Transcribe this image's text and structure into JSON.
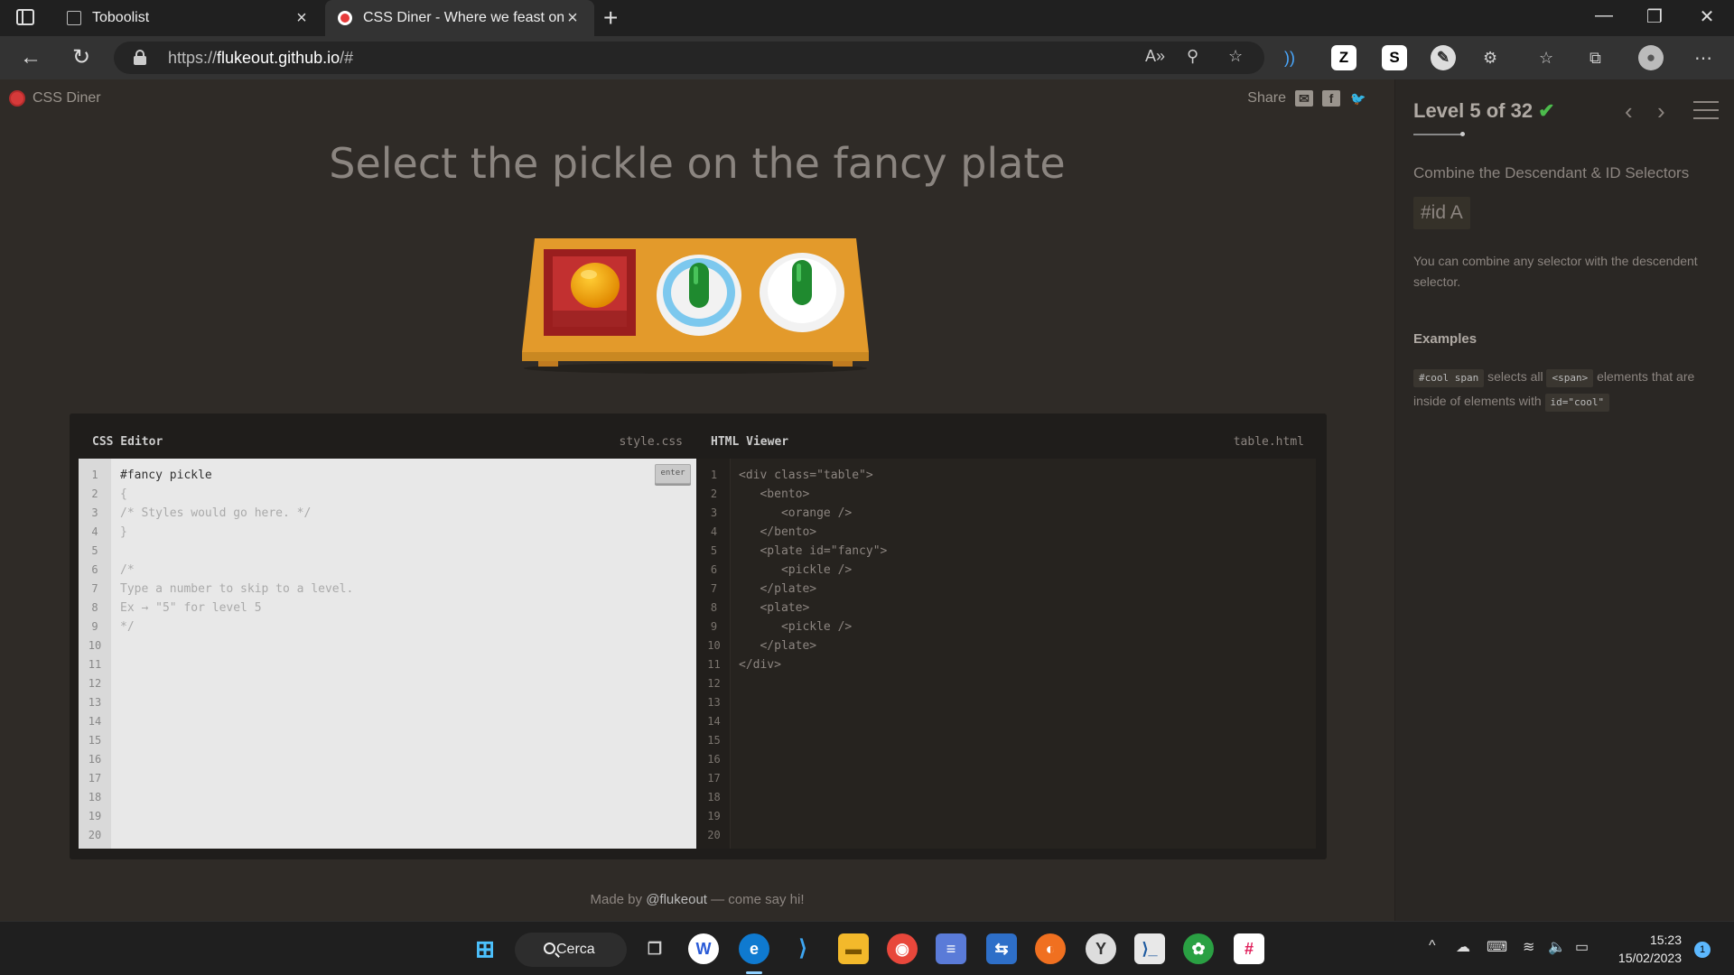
{
  "browser": {
    "tabs": [
      {
        "title": "Toboolist",
        "active": false
      },
      {
        "title": "CSS Diner - Where we feast on C",
        "active": true
      }
    ],
    "url_prefix": "https://",
    "url_host": "flukeout.github.io",
    "url_suffix": "/#"
  },
  "game": {
    "logo": "CSS Diner",
    "share_label": "Share",
    "order": "Select the pickle on the fancy plate",
    "css_editor": {
      "title": "CSS Editor",
      "filename": "style.css",
      "enter_label": "enter",
      "typed": "#fancy pickle",
      "lines": [
        "{",
        "/* Styles would go here. */",
        "}",
        "",
        "/*",
        "Type a number to skip to a level.",
        "Ex → \"5\" for level 5",
        "*/"
      ]
    },
    "html_viewer": {
      "title": "HTML Viewer",
      "filename": "table.html",
      "lines": [
        "<div class=\"table\">",
        "   <bento>",
        "      <orange />",
        "   </bento>",
        "   <plate id=\"fancy\">",
        "      <pickle />",
        "   </plate>",
        "   <plate>",
        "      <pickle />",
        "   </plate>",
        "</div>"
      ]
    },
    "line_count": 20,
    "footer_prefix": "Made by ",
    "footer_handle": "@flukeout",
    "footer_suffix": " — come say hi!"
  },
  "sidebar": {
    "level_text": "Level 5 of 32",
    "level_completed": true,
    "progress": 0.156,
    "selector_name": "Combine the Descendant & ID Selectors",
    "syntax": "#id  A",
    "hint": "You can combine any selector with the descendent selector.",
    "examples_title": "Examples",
    "example": {
      "code1": "#cool span",
      "text1": " selects all ",
      "code2": "<span>",
      "text2": " elements that are inside of elements with ",
      "code3": "id=\"cool\""
    }
  },
  "taskbar": {
    "search_label": "Cerca",
    "time": "15:23",
    "date": "15/02/2023",
    "notification_count": "1"
  },
  "colors": {
    "accent_check": "#4cbb4c",
    "table_wood": "#e0a030",
    "bento_red": "#b02828",
    "pickle_green": "#2aa038"
  }
}
